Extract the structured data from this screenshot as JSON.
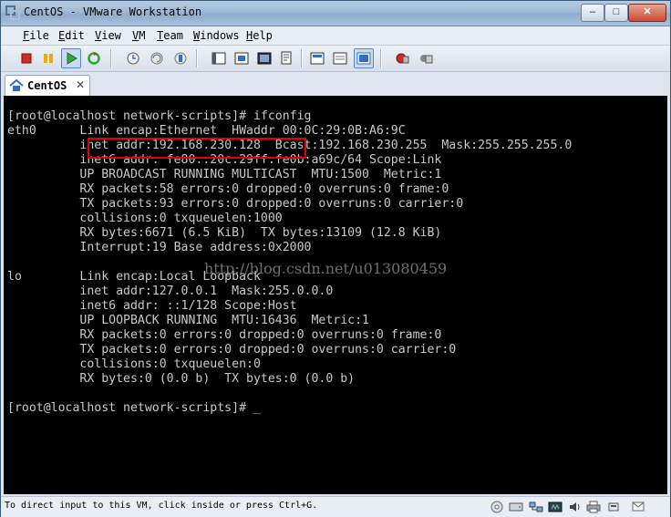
{
  "window": {
    "title": "CentOS - VMware Workstation"
  },
  "title_controls": {
    "minimize": "–",
    "maximize": "□",
    "close": "✕"
  },
  "menu": {
    "items": [
      {
        "label": "File"
      },
      {
        "label": "Edit"
      },
      {
        "label": "View"
      },
      {
        "label": "VM"
      },
      {
        "label": "Team"
      },
      {
        "label": "Windows"
      },
      {
        "label": "Help"
      }
    ]
  },
  "toolbar": {
    "buttons": [
      {
        "icon": "power-off-icon"
      },
      {
        "icon": "pause-icon"
      },
      {
        "icon": "play-icon"
      },
      {
        "icon": "reset-icon"
      },
      {
        "icon": "snapshot-icon"
      },
      {
        "icon": "revert-snapshot-icon"
      },
      {
        "icon": "snapshot-manager-icon"
      },
      {
        "icon": "normal-view-icon"
      },
      {
        "icon": "quick-switch-icon"
      },
      {
        "icon": "full-screen-icon"
      },
      {
        "icon": "summary-view-icon"
      },
      {
        "icon": "console-view-icon"
      },
      {
        "icon": "appliance-view-icon"
      },
      {
        "icon": "unity-icon"
      },
      {
        "icon": "vm-settings-icon"
      },
      {
        "icon": "send-ctrl-alt-del-icon"
      }
    ],
    "accent": "#2e6fc2"
  },
  "tab": {
    "label": "CentOS",
    "close": "✕"
  },
  "terminal": {
    "lines": [
      "[root@localhost network-scripts]# ifconfig",
      "eth0      Link encap:Ethernet  HWaddr 00:0C:29:0B:A6:9C",
      "          inet addr:192.168.230.128  Bcast:192.168.230.255  Mask:255.255.255.0",
      "          inet6 addr: fe80::20c:29ff:fe0b:a69c/64 Scope:Link",
      "          UP BROADCAST RUNNING MULTICAST  MTU:1500  Metric:1",
      "          RX packets:58 errors:0 dropped:0 overruns:0 frame:0",
      "          TX packets:93 errors:0 dropped:0 overruns:0 carrier:0",
      "          collisions:0 txqueuelen:1000",
      "          RX bytes:6671 (6.5 KiB)  TX bytes:13109 (12.8 KiB)",
      "          Interrupt:19 Base address:0x2000",
      "",
      "lo        Link encap:Local Loopback",
      "          inet addr:127.0.0.1  Mask:255.0.0.0",
      "          inet6 addr: ::1/128 Scope:Host",
      "          UP LOOPBACK RUNNING  MTU:16436  Metric:1",
      "          RX packets:0 errors:0 dropped:0 overruns:0 frame:0",
      "          TX packets:0 errors:0 dropped:0 overruns:0 carrier:0",
      "          collisions:0 txqueuelen:0",
      "          RX bytes:0 (0.0 b)  TX bytes:0 (0.0 b)",
      "",
      "[root@localhost network-scripts]# _"
    ],
    "text_color": "#c8c8c8",
    "highlight_color": "#e20000"
  },
  "watermark": "http://blog.csdn.net/u013080459",
  "status": {
    "text": "To direct input to this VM, click inside or press Ctrl+G.",
    "icons": [
      {
        "icon": "cd-drive-icon"
      },
      {
        "icon": "hard-disk-icon"
      },
      {
        "icon": "network-adapter-icon"
      },
      {
        "icon": "sound-icon"
      },
      {
        "icon": "printer-icon"
      },
      {
        "icon": "usb-icon"
      },
      {
        "icon": "messages-icon"
      }
    ]
  }
}
